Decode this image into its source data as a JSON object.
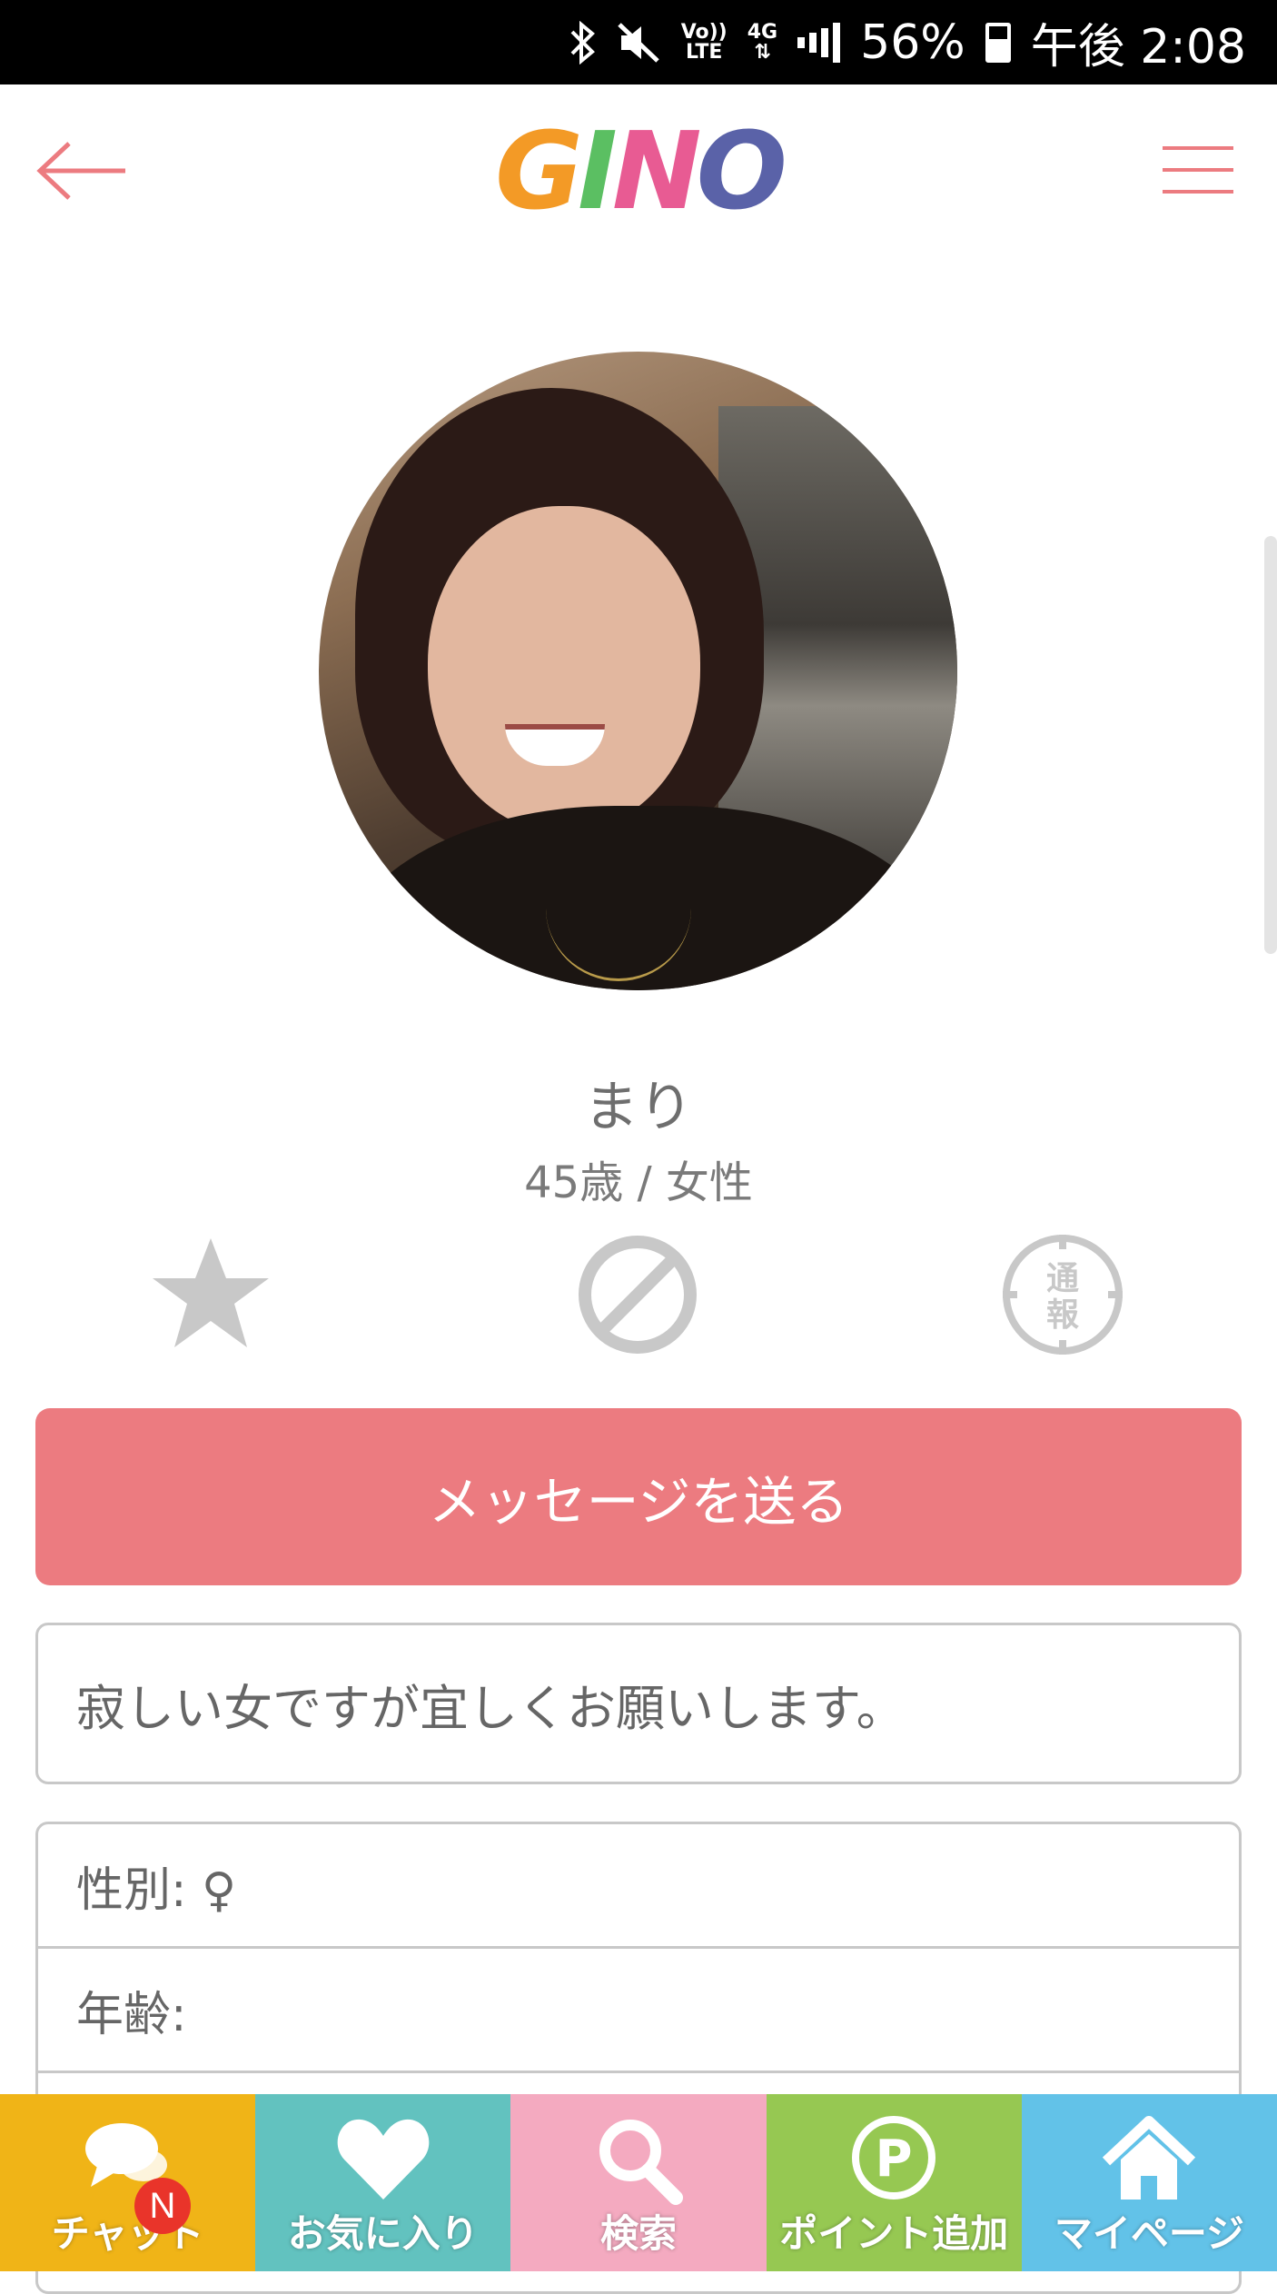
{
  "status_bar": {
    "battery_percent": "56%",
    "time": "午後 2:08",
    "network_lte": "LTE",
    "network_4g": "4G",
    "volte": "Vo))",
    "icons": [
      "bluetooth-icon",
      "mute-icon",
      "signal-icon",
      "battery-icon"
    ]
  },
  "header": {
    "logo_letters": [
      "G",
      "I",
      "N",
      "O"
    ],
    "logo_colors": [
      "#f39a26",
      "#5bbf62",
      "#e85b93",
      "#5a62a8"
    ],
    "back_icon": "arrow-left-icon",
    "menu_icon": "hamburger-menu-icon",
    "accent_color": "#ec7b80"
  },
  "profile": {
    "name": "まり",
    "age_gender": "45歳 / 女性",
    "actions": {
      "favorite_icon": "star-icon",
      "block_icon": "block-icon",
      "report_label_1": "通",
      "report_label_2": "報"
    },
    "message_button": "メッセージを送る",
    "intro": "寂しい女ですが宜しくお願いします。",
    "details": [
      {
        "label": "性別: ♀"
      },
      {
        "label": "年齢:"
      },
      {
        "label": ""
      }
    ]
  },
  "bottom_nav": {
    "items": [
      {
        "label": "チャット",
        "icon": "chat-bubble-icon",
        "color": "#f0b417"
      },
      {
        "label": "お気に入り",
        "icon": "heart-icon",
        "color": "#62c2bf"
      },
      {
        "label": "検索",
        "icon": "search-icon",
        "color": "#f4aac0"
      },
      {
        "label": "ポイント追加",
        "icon": "point-icon",
        "color": "#96c852"
      },
      {
        "label": "マイページ",
        "icon": "home-icon",
        "color": "#62c2e8"
      }
    ],
    "chat_badge": "N",
    "point_symbol": "P"
  }
}
